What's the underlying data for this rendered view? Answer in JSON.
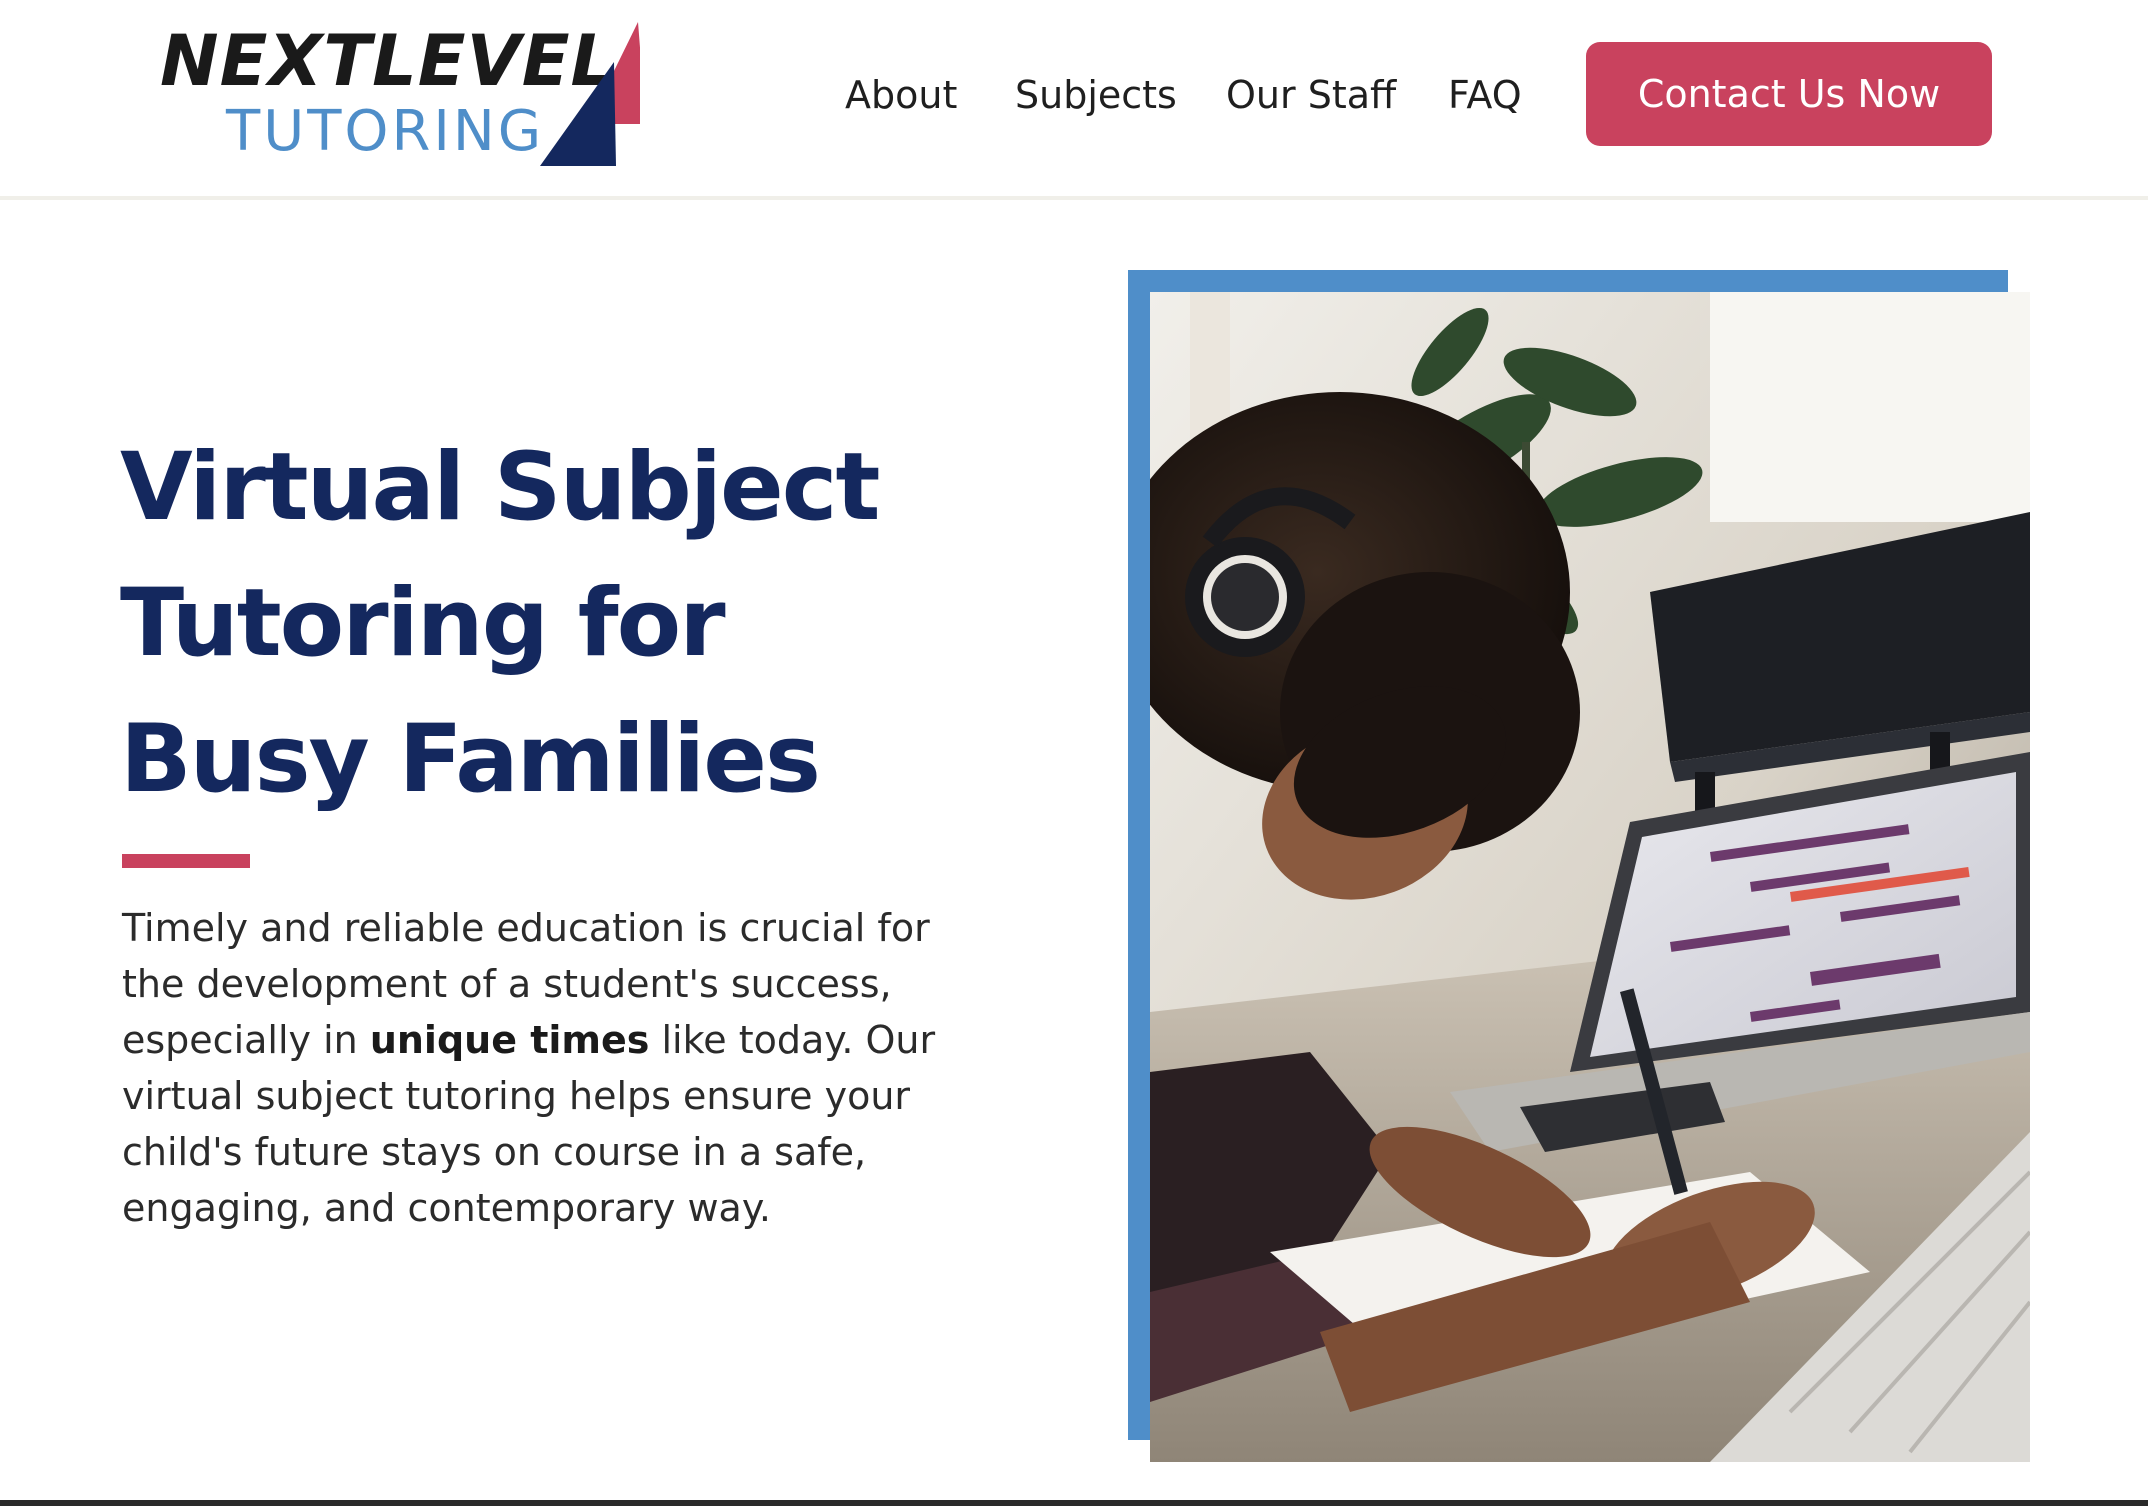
{
  "header": {
    "logo": {
      "word_1": "NEXTLEVEL",
      "word_2": "TUTORING"
    },
    "nav": [
      {
        "label": "About"
      },
      {
        "label": "Subjects"
      },
      {
        "label": "Our Staff"
      },
      {
        "label": "FAQ"
      }
    ],
    "cta_label": "Contact Us Now"
  },
  "hero": {
    "title_lines": [
      "Virtual Subject",
      "Tutoring for",
      "Busy Families"
    ],
    "body_before": "Timely and reliable education is crucial for the development of a student's success, especially in ",
    "body_bold": "unique times",
    "body_after": " like today. Our virtual subject tutoring helps ensure your child's future stays on course in a safe, engaging, and contemporary way."
  },
  "colors": {
    "navy": "#14285e",
    "accent_red": "#c9425e",
    "accent_blue": "#4f8ec9",
    "text_dark": "#2b2b2b"
  },
  "icons": {
    "logo_mark": "triangle-logo-icon",
    "hero_image": "student-with-headphones-laptop-photo"
  }
}
